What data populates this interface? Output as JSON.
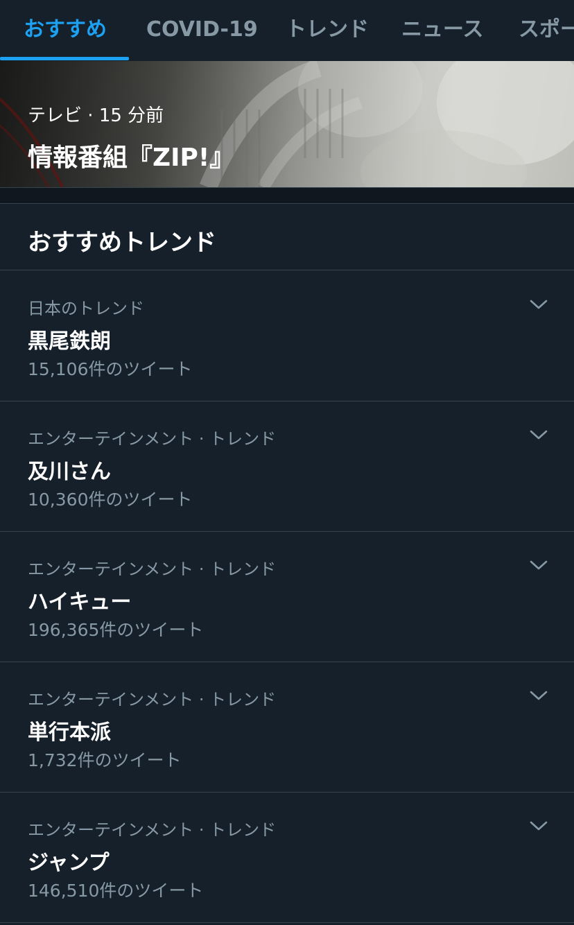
{
  "tabs": [
    {
      "label": "おすすめ",
      "active": true
    },
    {
      "label": "COVID-19",
      "active": false
    },
    {
      "label": "トレンド",
      "active": false
    },
    {
      "label": "ニュース",
      "active": false
    },
    {
      "label": "スポー",
      "active": false
    }
  ],
  "hero": {
    "category": "テレビ",
    "time": "15 分前",
    "title": "情報番組『ZIP!』"
  },
  "section": {
    "title": "おすすめトレンド"
  },
  "trends": [
    {
      "context": "日本のトレンド",
      "name": "黒尾鉄朗",
      "count": "15,106件のツイート",
      "icon": "chevron-down-icon"
    },
    {
      "context": "エンターテインメント · トレンド",
      "name": "及川さん",
      "count": "10,360件のツイート",
      "icon": "chevron-down-icon"
    },
    {
      "context": "エンターテインメント · トレンド",
      "name": "ハイキュー",
      "count": "196,365件のツイート",
      "icon": "chevron-down-icon"
    },
    {
      "context": "エンターテインメント · トレンド",
      "name": "単行本派",
      "count": "1,732件のツイート",
      "icon": "chevron-down-icon"
    },
    {
      "context": "エンターテインメント · トレンド",
      "name": "ジャンプ",
      "count": "146,510件のツイート",
      "icon": "chevron-down-icon"
    }
  ],
  "colors": {
    "background": "#15202b",
    "accent": "#1da1f2",
    "secondary_text": "#8899a6",
    "divider": "#38444d"
  }
}
